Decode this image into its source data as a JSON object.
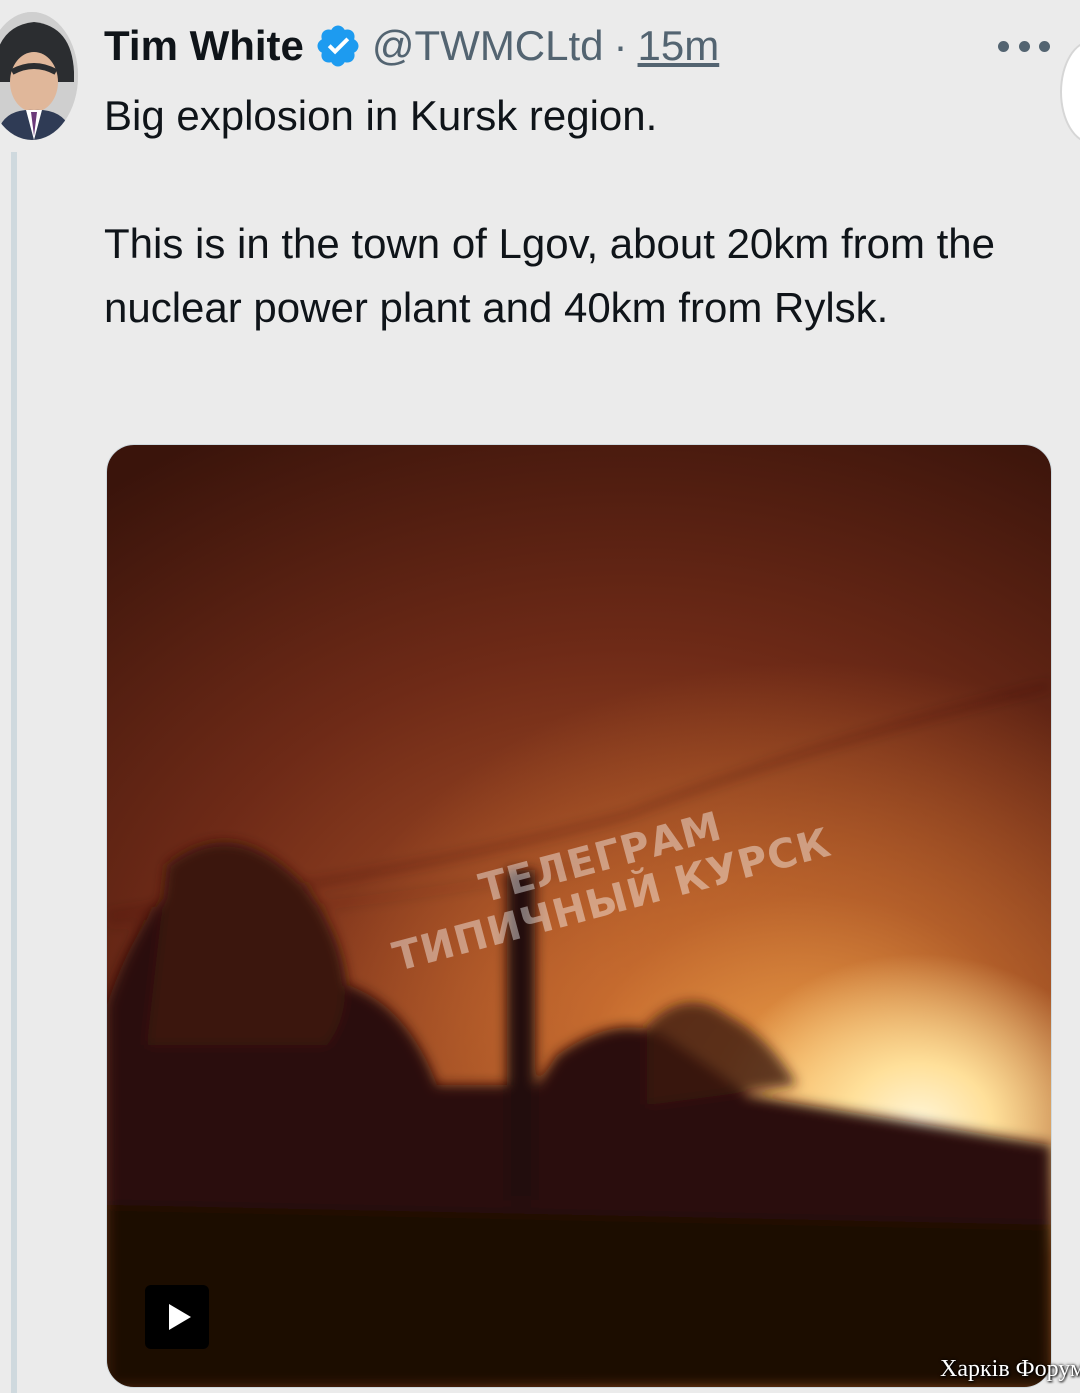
{
  "tweet": {
    "display_name": "Tim White",
    "handle": "@TWMCLtd",
    "separator": "·",
    "time": "15m",
    "text_paragraphs": [
      "Big explosion in Kursk region.",
      "This is in the town of Lgov, about 20km from the nuclear power plant and 40km from Rylsk."
    ]
  },
  "media": {
    "watermark_lines": [
      "ТЕЛЕГРАМ",
      "ТИПИЧНЫЙ КУРСК"
    ]
  },
  "footer_watermark": "Харків Форум",
  "icons": {
    "verified": "verified-badge-icon",
    "more": "more-options-icon",
    "play": "play-icon"
  },
  "colors": {
    "background": "#ebebeb",
    "text": "#0f1419",
    "secondary_text": "#536471",
    "verified": "#1d9bf0"
  }
}
